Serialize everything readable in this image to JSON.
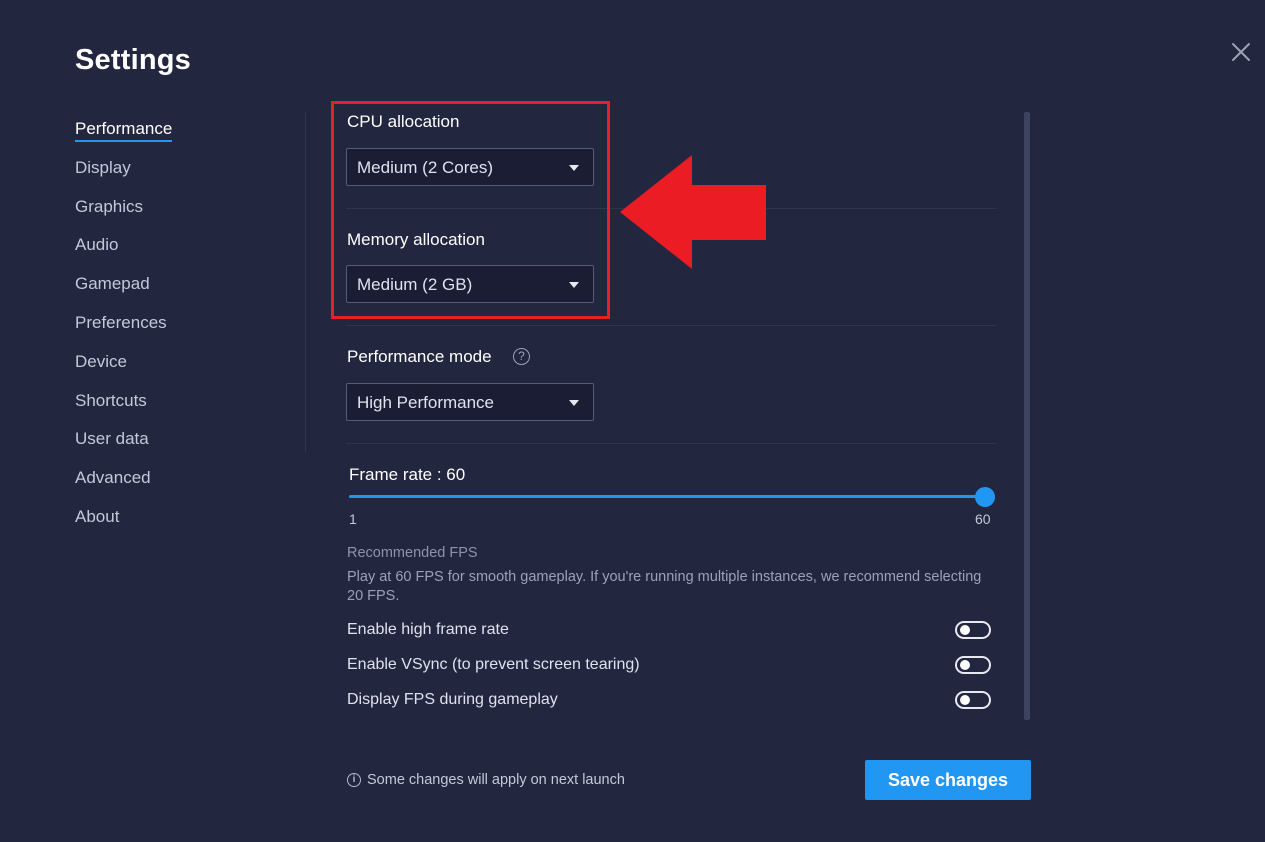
{
  "window": {
    "title": "Settings",
    "close_icon": "close-icon"
  },
  "sidebar": {
    "items": [
      {
        "label": "Performance",
        "active": true
      },
      {
        "label": "Display"
      },
      {
        "label": "Graphics"
      },
      {
        "label": "Audio"
      },
      {
        "label": "Gamepad"
      },
      {
        "label": "Preferences"
      },
      {
        "label": "Device"
      },
      {
        "label": "Shortcuts"
      },
      {
        "label": "User data"
      },
      {
        "label": "Advanced"
      },
      {
        "label": "About"
      }
    ]
  },
  "performance": {
    "cpu": {
      "label": "CPU allocation",
      "value": "Medium (2 Cores)"
    },
    "memory": {
      "label": "Memory allocation",
      "value": "Medium (2 GB)"
    },
    "mode": {
      "label": "Performance mode",
      "value": "High Performance",
      "help_icon": "question-circle-icon"
    },
    "frame_rate": {
      "label": "Frame rate : 60",
      "min_label": "1",
      "max_label": "60",
      "min": 1,
      "max": 60,
      "value": 60
    },
    "recommended": {
      "title": "Recommended FPS",
      "text": "Play at 60 FPS for smooth gameplay. If you're running multiple instances, we recommend selecting 20 FPS."
    },
    "toggles": [
      {
        "label": "Enable high frame rate",
        "on": false
      },
      {
        "label": "Enable VSync (to prevent screen tearing)",
        "on": false
      },
      {
        "label": "Display FPS during gameplay",
        "on": false
      }
    ]
  },
  "annotation": {
    "highlight_color": "#e81f27",
    "arrow_color": "#ec1c24"
  },
  "footer": {
    "note": "Some changes will apply on next launch",
    "save_label": "Save changes"
  },
  "colors": {
    "background": "#22263f",
    "accent": "#2196f3",
    "select_bg": "#1a1d33"
  }
}
